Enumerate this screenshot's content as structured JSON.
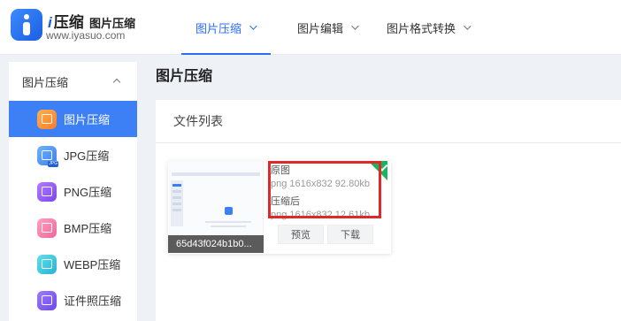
{
  "logo": {
    "brand_i": "i",
    "brand_name": "压缩",
    "product_name": "图片压缩",
    "url": "www.iyasuo.com"
  },
  "nav": {
    "items": [
      {
        "label": "图片压缩",
        "active": true
      },
      {
        "label": "图片编辑",
        "active": false
      },
      {
        "label": "图片格式转换",
        "active": false
      }
    ]
  },
  "sidebar": {
    "group_label": "图片压缩",
    "items": [
      {
        "label": "图片压缩",
        "icon": "image-compress-icon",
        "active": true
      },
      {
        "label": "JPG压缩",
        "icon": "jpg-icon",
        "tag": "JPG"
      },
      {
        "label": "PNG压缩",
        "icon": "png-icon"
      },
      {
        "label": "BMP压缩",
        "icon": "bmp-icon"
      },
      {
        "label": "WEBP压缩",
        "icon": "webp-icon"
      },
      {
        "label": "证件照压缩",
        "icon": "id-photo-icon"
      }
    ]
  },
  "main": {
    "page_title": "图片压缩",
    "panel_title": "文件列表",
    "file": {
      "name": "65d43f024b1b0...",
      "original_label": "原图",
      "original_info": "png  1616x832  92.80kb",
      "compressed_label": "压缩后",
      "compressed_info": "png  1616x832  12.61kb",
      "preview_label": "预览",
      "download_label": "下载"
    }
  },
  "colors": {
    "accent": "#2a6ef5",
    "sidebar_active": "#3d80f5",
    "success_corner": "#18b55e",
    "highlight": "#e02828"
  }
}
